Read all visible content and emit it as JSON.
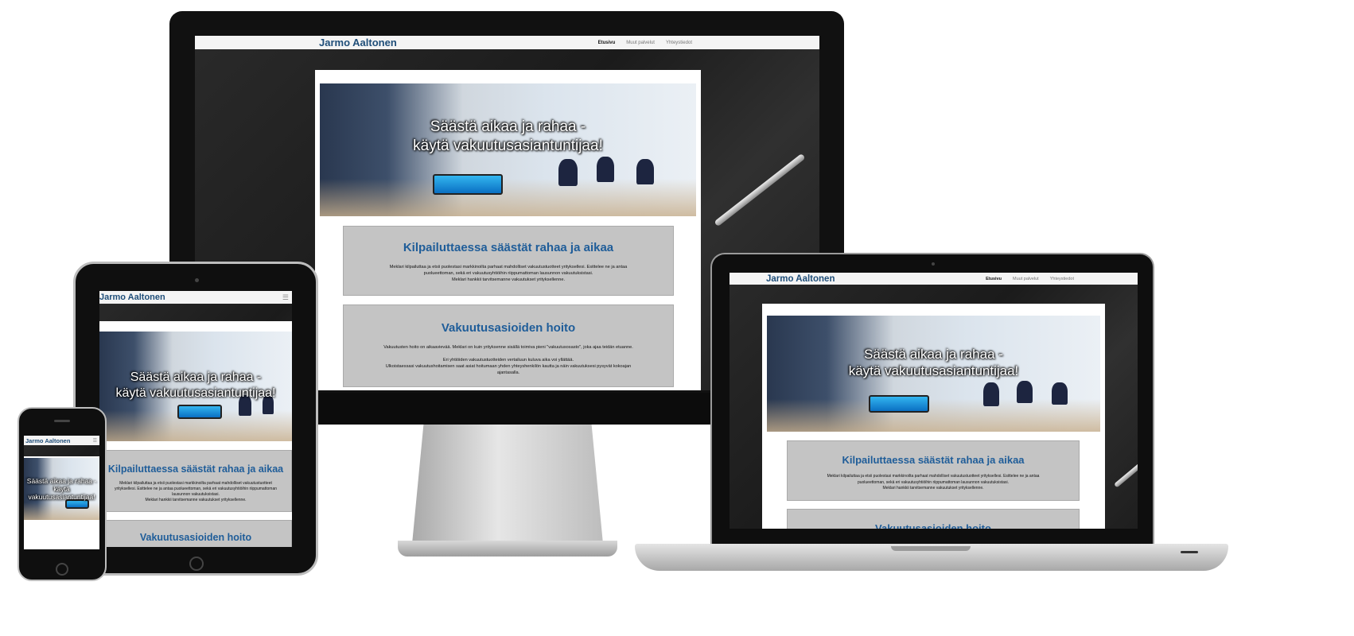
{
  "site": {
    "brand": "Jarmo Aaltonen",
    "nav": [
      {
        "label": "Etusivu",
        "active": true
      },
      {
        "label": "Muut palvelut",
        "active": false
      },
      {
        "label": "Yhteystiedot",
        "active": false
      }
    ],
    "menu_icon": "hamburger-icon",
    "hero": {
      "line1": "Säästä aikaa ja rahaa -",
      "line2": "käytä vakuutusasiantuntijaa!"
    },
    "section1": {
      "title": "Kilpailuttaessa säästät rahaa ja aikaa",
      "p1": "Meklari kilpailuttaa ja etsii puolestasi markkinoilta parhaat mahdolliset vakuutustuotteet yrityksellesi. Esittelee ne ja antaa puolueettoman, sekä eri vakuutusyhtiöihin riippumattoman lausunnon vakuutuksistasi.",
      "p2": "Meklari hankkii tarvitsemanne vakuutukset yrityksellenne."
    },
    "section2": {
      "title": "Vakuutusasioiden hoito",
      "p1": "Vakuutusten hoito on aikaavievää. Meklari on kuin yrityksenne sisällä toimiva pieni \"vakuutusosasto\", joka ajaa teidän etuanne.",
      "p2": "Eri yhtiöiden vakuutustuotteiden vertailuun kuluva aika voi yllättää.",
      "p3": "Ulkoistaessasi vakuutushoitamisen saat asiat hoitumaan yhden yhteyshenkilön kautta ja näin vakuutuksesi pysyvät kokoajan ajantasalla."
    }
  },
  "colors": {
    "brand": "#1f4e79",
    "heading": "#1f5d99",
    "card_bg": "#c4c4c4",
    "navbar_bg": "#f4f4f4"
  }
}
